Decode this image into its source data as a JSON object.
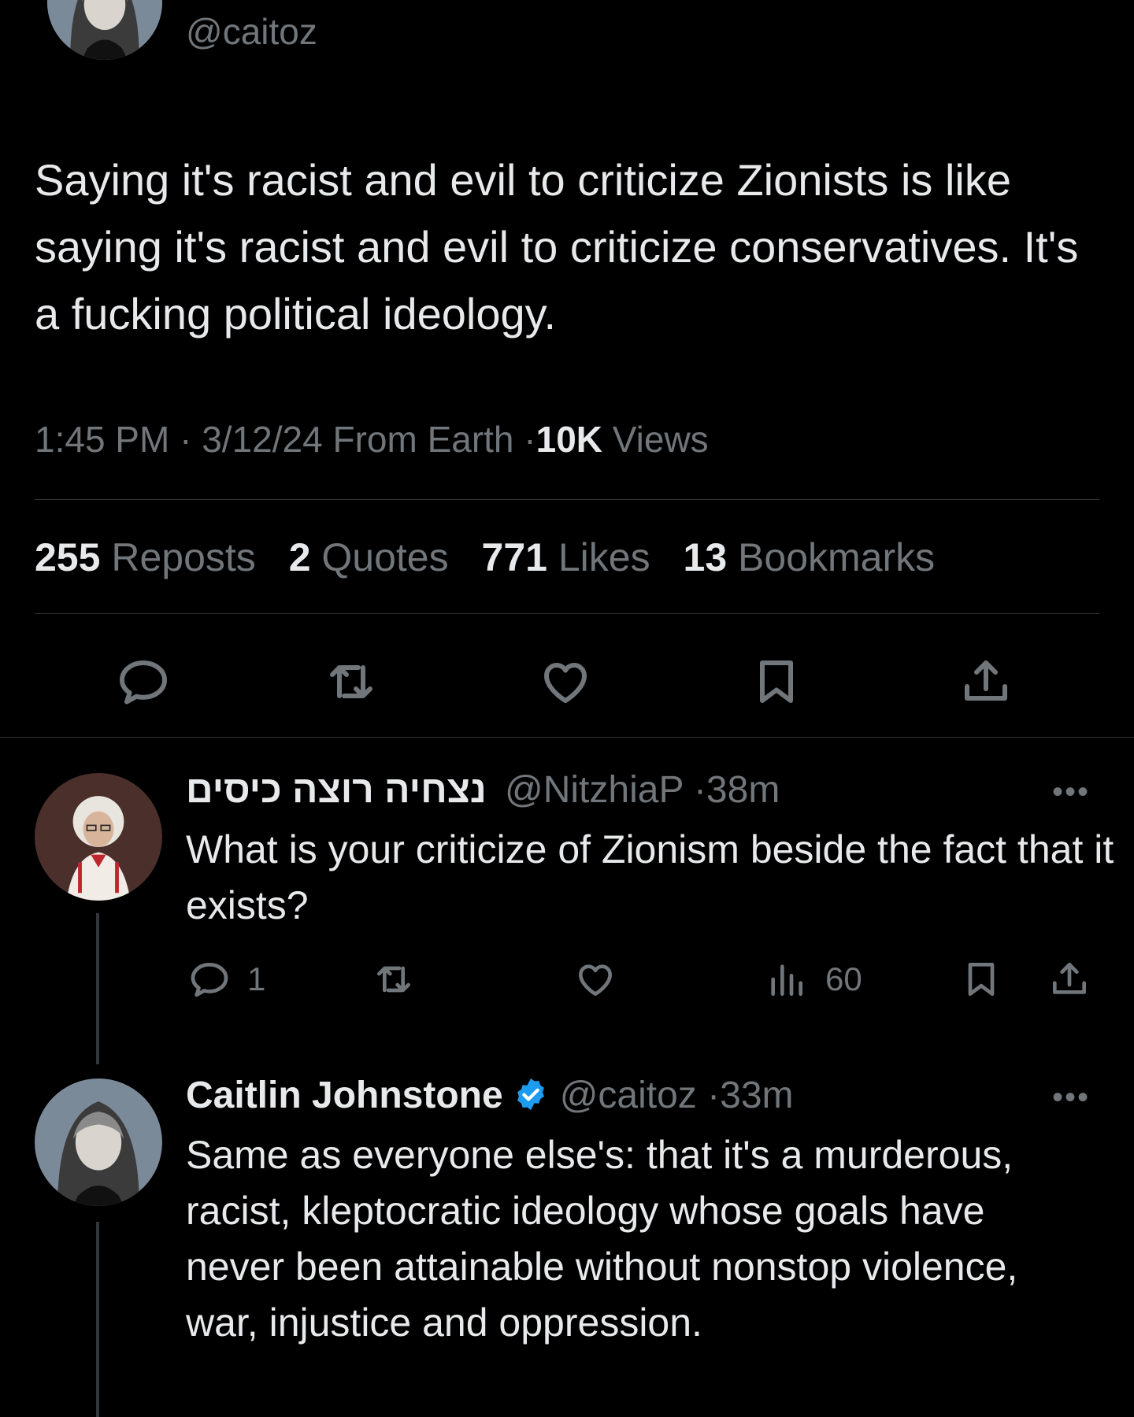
{
  "main_tweet": {
    "handle": "@caitoz",
    "text": "Saying it's racist and evil to criticize Zionists is like saying it's racist and evil to criticize conservatives. It's a fucking political ideology.",
    "time": "1:45 PM",
    "date": "3/12/24",
    "source": "From Earth",
    "separator": "·",
    "views_count": "10K",
    "views_label": "Views",
    "stats": {
      "reposts_count": "255",
      "reposts_label": "Reposts",
      "quotes_count": "2",
      "quotes_label": "Quotes",
      "likes_count": "771",
      "likes_label": "Likes",
      "bookmarks_count": "13",
      "bookmarks_label": "Bookmarks"
    },
    "actions": [
      "reply-icon",
      "repost-icon",
      "like-icon",
      "bookmark-icon",
      "share-icon"
    ]
  },
  "replies": [
    {
      "display_name": "נצחיה רוצה כיסים",
      "handle": "@NitzhiaP",
      "separator": "·",
      "time": "38m",
      "text": "What is your criticize of Zionism beside the fact that it exists?",
      "more": "•••",
      "reply_count": "1",
      "views_count": "60"
    },
    {
      "display_name": "Caitlin Johnstone",
      "verified": true,
      "handle": "@caitoz",
      "separator": "·",
      "time": "33m",
      "text": "Same as everyone else's: that it's a murderous, racist, kleptocratic ideology whose goals have never been attainable without nonstop violence, war, injustice and oppression.",
      "more": "•••"
    }
  ],
  "colors": {
    "background": "#000000",
    "text_primary": "#e7e9ea",
    "text_secondary": "#71767b",
    "divider": "#2f3336",
    "verified": "#1d9bf0"
  }
}
